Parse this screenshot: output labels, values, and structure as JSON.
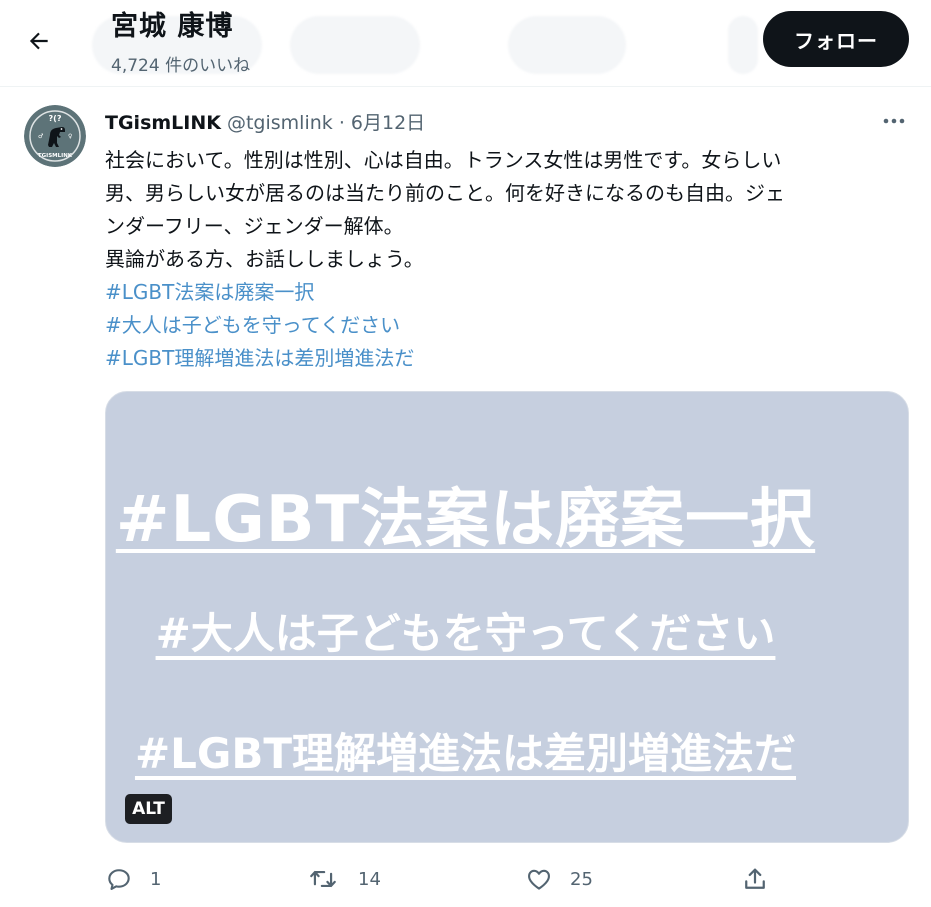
{
  "header": {
    "title": "宮城 康博",
    "subtitle": "4,724 件のいいね",
    "follow_label": "フォロー"
  },
  "tweet": {
    "display_name": "TGismLINK",
    "meta": "@tgismlink · 6月12日",
    "text_lines": [
      "社会において。性別は性別、心は自由。トランス女性は男性です。女らしい",
      "男、男らしい女が居るのは当たり前のこと。何を好きになるのも自由。ジェ",
      "ンダーフリー、ジェンダー解体。",
      "異論がある方、お話ししましょう。"
    ],
    "hashtags": [
      "#LGBT法案は廃案一択",
      "#大人は子どもを守ってください",
      "#LGBT理解増進法は差別増進法だ"
    ]
  },
  "media": {
    "lines": [
      "#LGBT法案は廃案一択",
      "#大人は子どもを守ってください",
      "#LGBT理解増進法は差別増進法だ"
    ],
    "alt_label": "ALT",
    "avatar_text": "TGISMLINK"
  },
  "actions": {
    "reply_count": "1",
    "retweet_count": "14",
    "like_count": "25"
  },
  "colors": {
    "hashtag": "#4a90c9",
    "media_bg": "#c6cfdf",
    "follow_bg": "#0f1419",
    "avatar_bg": "#5d7378"
  },
  "icons": [
    "back-arrow-icon",
    "more-icon",
    "reply-icon",
    "retweet-icon",
    "like-icon",
    "share-icon"
  ]
}
